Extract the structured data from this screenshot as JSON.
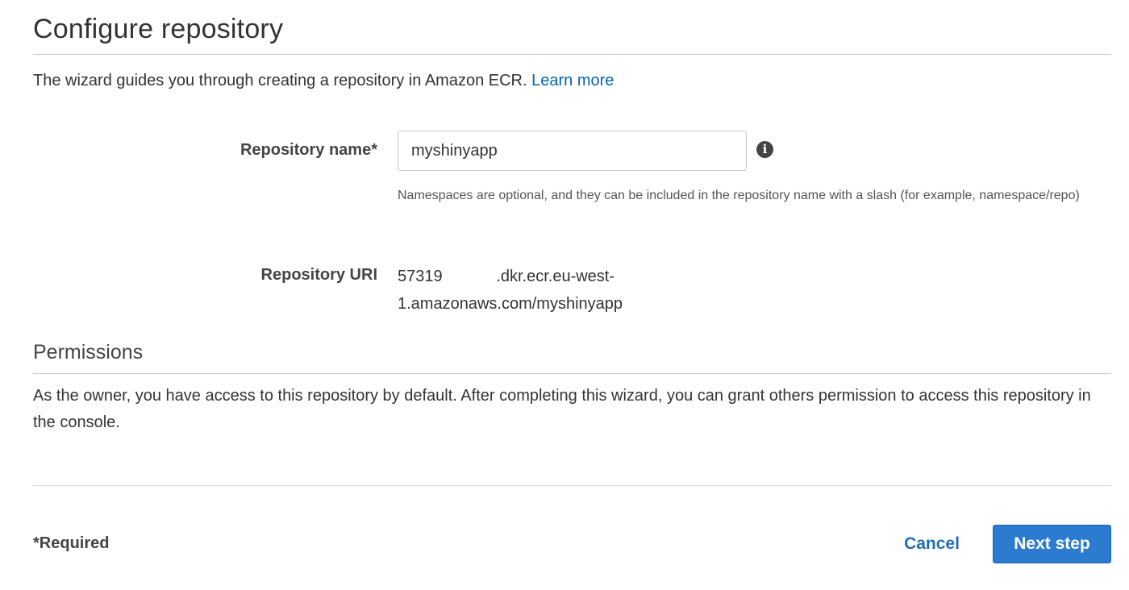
{
  "header": {
    "title": "Configure repository",
    "intro": "The wizard guides you through creating a repository in Amazon ECR.",
    "learn_more": "Learn more"
  },
  "form": {
    "repo_name_label": "Repository name*",
    "repo_name_value": "myshinyapp",
    "info_icon": "info-circle-icon",
    "namespace_help": "Namespaces are optional, and they can be included in the repository name with a slash (for example, namespace/repo)",
    "repo_uri_label": "Repository URI",
    "repo_uri_line1": "57319            .dkr.ecr.eu-west-",
    "repo_uri_line2": "1.amazonaws.com/myshinyapp"
  },
  "permissions": {
    "title": "Permissions",
    "text": "As the owner, you have access to this repository by default. After completing this wizard, you can grant others permission to access this repository in the console."
  },
  "footer": {
    "required_note": "*Required",
    "cancel_label": "Cancel",
    "next_label": "Next step"
  },
  "colors": {
    "link": "#0066b3",
    "primary_button": "#2b7bd0",
    "divider": "#cccccc"
  }
}
